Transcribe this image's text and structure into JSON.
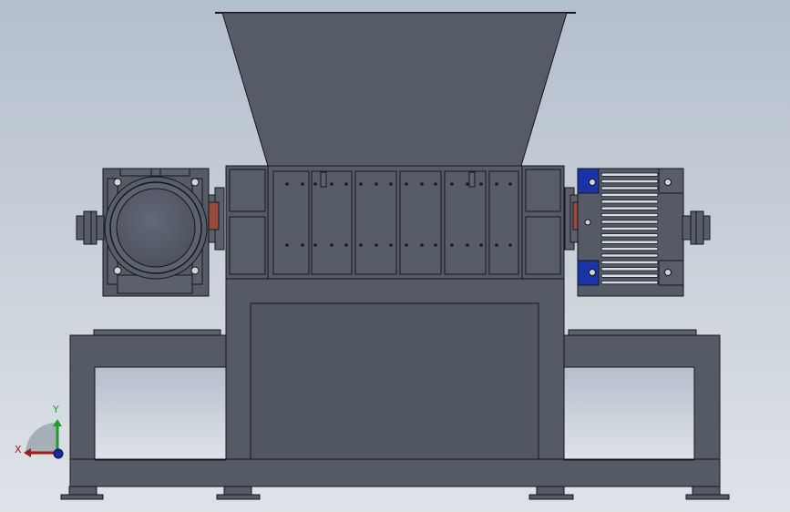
{
  "viewport": {
    "background_top": "#b4bfcc",
    "background_bottom": "#dee3e8"
  },
  "model": {
    "body_color": "#545a66",
    "body_color_light": "#5c6370",
    "outline_color": "#15171c",
    "bearing_accent": "#1a34a8",
    "coupling_accent": "#9a4a3a"
  },
  "triad": {
    "x_label": "X",
    "y_label": "Y",
    "x_color": "#9b1c1c",
    "y_color": "#1f9b2a",
    "z_color": "#1a2a9c"
  }
}
